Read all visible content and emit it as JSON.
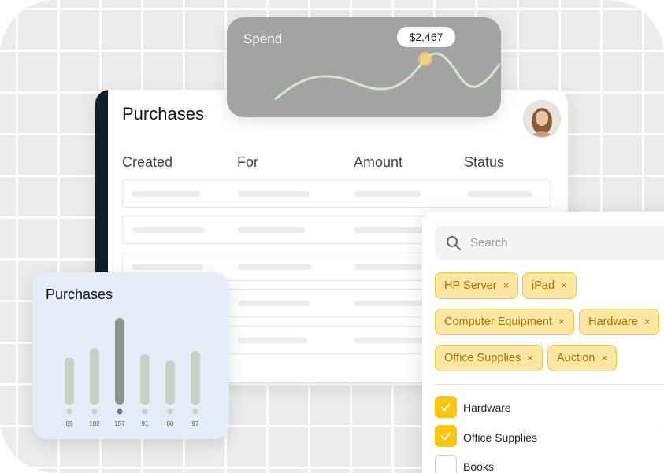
{
  "spend": {
    "label": "Spend",
    "tooltip": "$2,467"
  },
  "purchases_table": {
    "title": "Purchases",
    "columns": [
      "Created",
      "For",
      "Amount",
      "Status"
    ]
  },
  "purchases_chart": {
    "title": "Purchases"
  },
  "chart_data": {
    "type": "bar",
    "title": "Purchases",
    "categories": [
      "85",
      "102",
      "157",
      "91",
      "80",
      "97"
    ],
    "values": [
      85,
      102,
      157,
      91,
      80,
      97
    ],
    "highlight_index": 2,
    "colors": {
      "bar": "#c5d1c2",
      "highlight": "#8c968b",
      "label": "#555555"
    }
  },
  "filter": {
    "search_placeholder": "Search",
    "tags": [
      "HP Server",
      "iPad",
      "Computer Equipment",
      "Hardware",
      "Office Supplies",
      "Auction"
    ],
    "remove_glyph": "×",
    "checkboxes": [
      {
        "label": "Hardware",
        "checked": true
      },
      {
        "label": "Office Supplies",
        "checked": true
      },
      {
        "label": "Books",
        "checked": false
      }
    ]
  },
  "colors": {
    "tag_bg": "#fbe7a3",
    "tag_border": "#f3c737",
    "tag_text": "#a67300",
    "checkbox_on": "#f9c510",
    "sidebar": "#0f1e2b"
  }
}
